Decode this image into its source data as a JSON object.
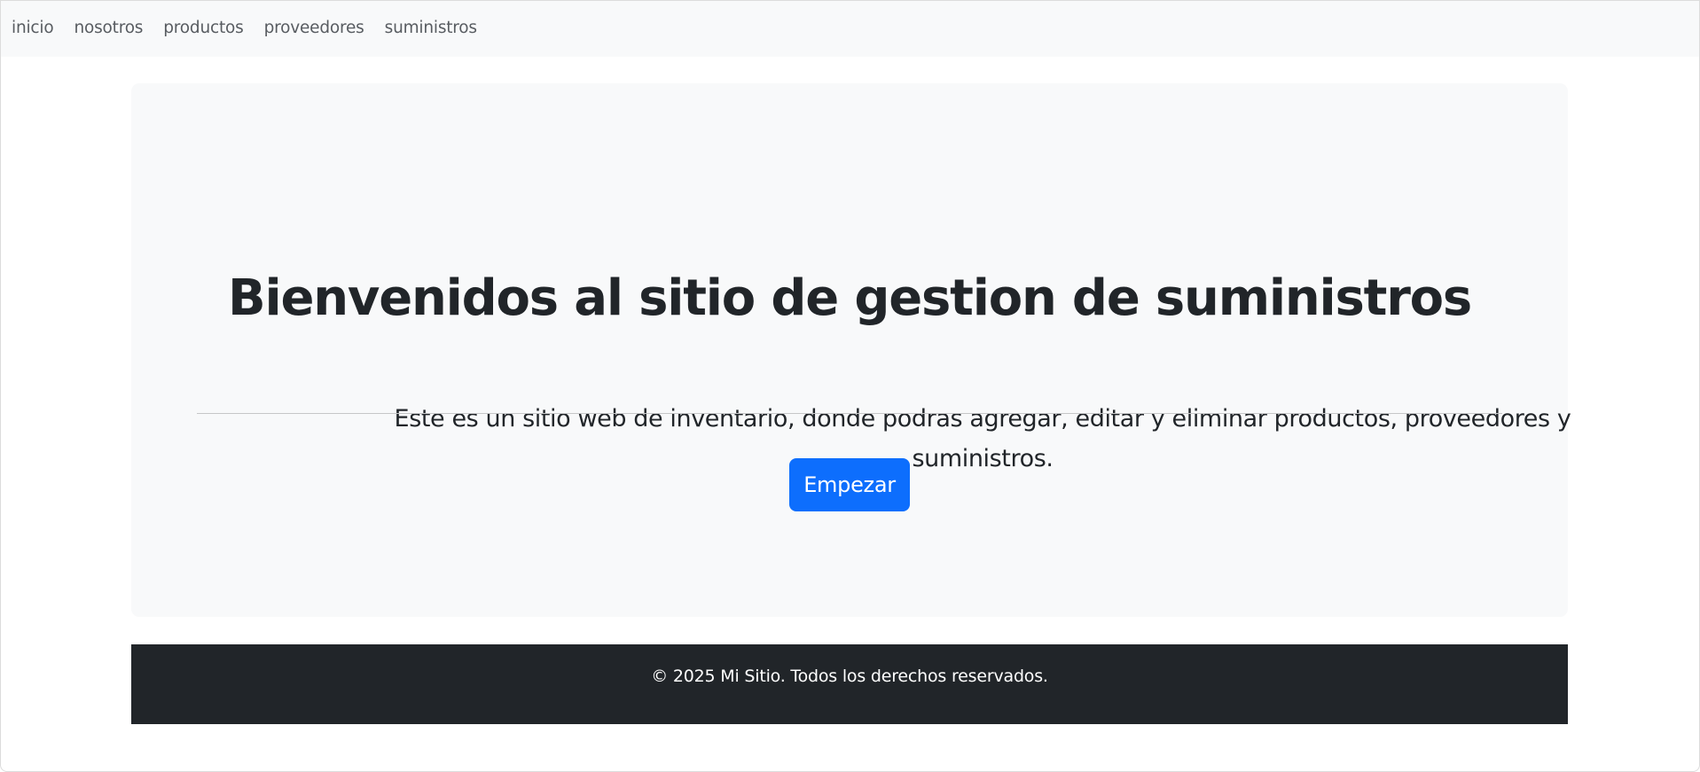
{
  "navbar": {
    "items": [
      {
        "label": "inicio"
      },
      {
        "label": "nosotros"
      },
      {
        "label": "productos"
      },
      {
        "label": "proveedores"
      },
      {
        "label": "suministros"
      }
    ]
  },
  "hero": {
    "title": "Bienvenidos al sitio de gestion de suministros",
    "description": "Este es un sitio web de inventario, donde podras agregar, editar y eliminar productos, proveedores y suministros.",
    "button_label": "Empezar"
  },
  "footer": {
    "text": "© 2025 Mi Sitio. Todos los derechos reservados."
  },
  "colors": {
    "primary": "#0d6efd",
    "navbar_bg": "#f8f9fa",
    "hero_bg": "#f8f9fa",
    "footer_bg": "#212529",
    "text": "#212529"
  }
}
